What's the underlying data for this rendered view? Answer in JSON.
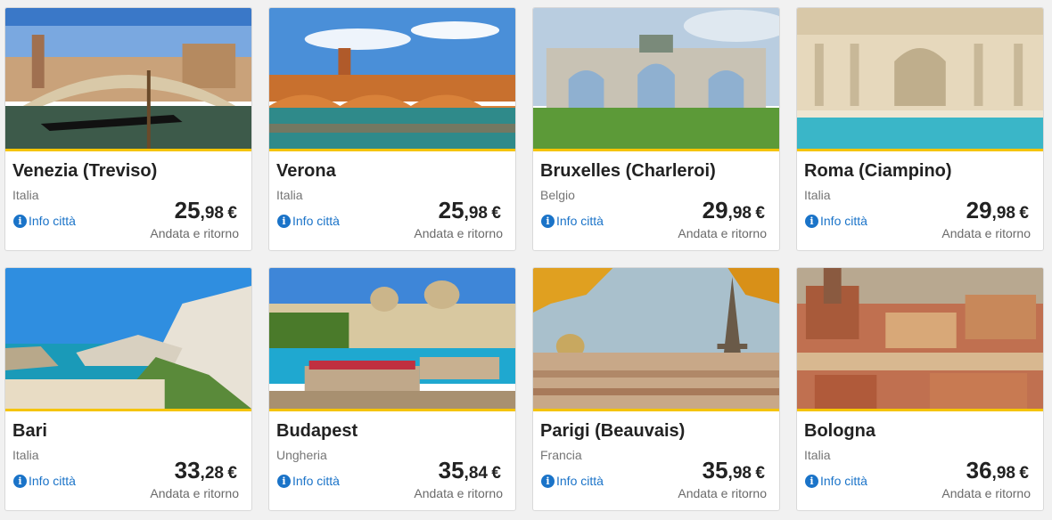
{
  "cards": [
    {
      "city": "Venezia (Treviso)",
      "country": "Italia",
      "info": "Info città",
      "price_int": "25",
      "price_dec": ",98",
      "currency": "€",
      "trip": "Andata e ritorno"
    },
    {
      "city": "Verona",
      "country": "Italia",
      "info": "Info città",
      "price_int": "25",
      "price_dec": ",98",
      "currency": "€",
      "trip": "Andata e ritorno"
    },
    {
      "city": "Bruxelles (Charleroi)",
      "country": "Belgio",
      "info": "Info città",
      "price_int": "29",
      "price_dec": ",98",
      "currency": "€",
      "trip": "Andata e ritorno"
    },
    {
      "city": "Roma (Ciampino)",
      "country": "Italia",
      "info": "Info città",
      "price_int": "29",
      "price_dec": ",98",
      "currency": "€",
      "trip": "Andata e ritorno"
    },
    {
      "city": "Bari",
      "country": "Italia",
      "info": "Info città",
      "price_int": "33",
      "price_dec": ",28",
      "currency": "€",
      "trip": "Andata e ritorno"
    },
    {
      "city": "Budapest",
      "country": "Ungheria",
      "info": "Info città",
      "price_int": "35",
      "price_dec": ",84",
      "currency": "€",
      "trip": "Andata e ritorno"
    },
    {
      "city": "Parigi (Beauvais)",
      "country": "Francia",
      "info": "Info città",
      "price_int": "35",
      "price_dec": ",98",
      "currency": "€",
      "trip": "Andata e ritorno"
    },
    {
      "city": "Bologna",
      "country": "Italia",
      "info": "Info città",
      "price_int": "36",
      "price_dec": ",98",
      "currency": "€",
      "trip": "Andata e ritorno"
    }
  ],
  "colors": {
    "accent": "#f5c400",
    "link": "#1a73c8"
  }
}
